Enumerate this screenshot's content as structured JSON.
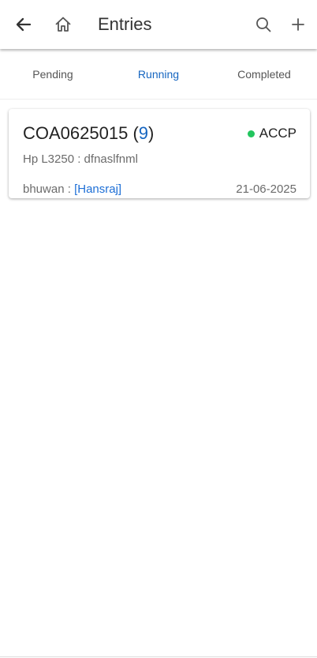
{
  "header": {
    "title": "Entries",
    "icons": [
      "back-arrow-icon",
      "home-icon",
      "search-icon",
      "plus-icon"
    ]
  },
  "tabs": [
    {
      "label": "Pending",
      "active": false
    },
    {
      "label": "Running",
      "active": true
    },
    {
      "label": "Completed",
      "active": false
    }
  ],
  "entries": [
    {
      "code": "COA0625015",
      "count_open": " (",
      "count": "9",
      "count_close": ")",
      "status": "ACCP",
      "status_color": "#22c55e",
      "device": "Hp L3250 : dfnaslfnml",
      "user": "bhuwan",
      "separator": " : ",
      "assignee": "[Hansraj]",
      "date": "21-06-2025"
    }
  ],
  "colors": {
    "accent": "#1565c0",
    "link": "#1e6fd6",
    "status_ok": "#22c55e"
  }
}
